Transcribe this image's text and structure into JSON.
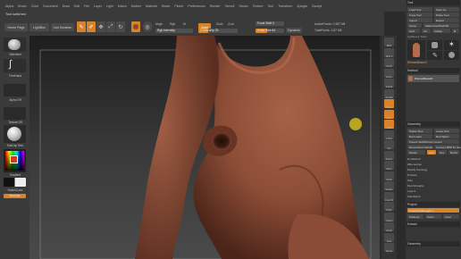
{
  "menu": [
    "Alpha",
    "Brush",
    "Color",
    "Document",
    "Draw",
    "Edit",
    "File",
    "Layer",
    "Light",
    "Macro",
    "Marker",
    "Material",
    "Movie",
    "Picker",
    "Preferences",
    "Render",
    "Stencil",
    "Stroke",
    "Texture",
    "Tool",
    "Transform",
    "Zplugin",
    "Zscript"
  ],
  "status": {
    "text": "Tool switched"
  },
  "toolbar": {
    "home_page": "Home Page",
    "lightbox": "LightBox",
    "live_boolean": "Live Boolean",
    "edit": "Edit",
    "draw": "Draw",
    "move": "Move",
    "scale": "Scale",
    "rotate": "Rotate",
    "mrgb": "Mrgb",
    "rgb": "Rgb",
    "m": "M",
    "zadd": "Zadd",
    "zsub": "Zsub",
    "zcut": "Zcut",
    "rgb_intensity": "Rgb Intensity",
    "z_intensity": "Z Intensity 25",
    "focal_shift": "Focal Shift 0",
    "draw_size": "Draw Size 64",
    "dynamic": "Dynamic",
    "active_points": "ActivePoints: 2.987 Mil",
    "total_points": "TotalPoints: 2.87 Mil",
    "z_intensity_level": 0.25,
    "rgb_intensity_level": 0.0
  },
  "left": {
    "standard": "Standard",
    "freehand": "FreeHand",
    "alpha_off": "Alpha Off",
    "texture_off": "Texture Off",
    "material": "MatCap Red",
    "gradient": "Gradient",
    "switch_color": "SwitchColor",
    "alternate": "Alternate"
  },
  "right_tools": [
    "BPR",
    "SPix 3",
    "Scroll",
    "Zoom",
    "Actual",
    "AAHalf",
    "Persp",
    "Floor",
    "Local",
    "L.Sym",
    "Xyz",
    "Frame",
    "Move",
    "Scale",
    "Rotate",
    "Line Fill",
    "PolyF",
    "Transp",
    "Ghost",
    "Solo",
    "Xpose"
  ],
  "right": {
    "title": "Tool",
    "load_tool": "Load Tool",
    "save_as": "Save As",
    "copy_tool": "Copy Tool",
    "paste_tool": "Paste Tool",
    "import": "Import",
    "export": "Export",
    "clone": "Clone",
    "make_polymesh": "Make PolyMesh3D",
    "goz": "GoZ",
    "all": "All",
    "visible": "Visible",
    "r": "R",
    "lightbox_tools": "Lightbox ▸ Tools",
    "tool_name": "WomanBase04",
    "subtool": "Subtool",
    "subtool_item": "WomanBase04",
    "geometry": "Geometry",
    "higher_res": "Higher Res",
    "lower_res": "Lower Res",
    "sdiv": "SDiv",
    "del_lower": "Del Lower",
    "del_higher": "Del Higher",
    "freeze": "Freeze SubDivision Levels",
    "reconstruct": "Reconstruct Subdiv",
    "convert_bpr": "Convert BPR To Geo",
    "divide": "Divide",
    "smt": "Smt",
    "suv": "Suv",
    "reuv": "ReUV",
    "dynamesh": "DynaMesh",
    "zremesher": "ZRemesher",
    "modify_topology": "Modify Topology",
    "position": "Position",
    "size": "Size",
    "meshintegrity": "MeshIntegrity",
    "layers": "Layers",
    "fibermesh": "FiberMesh",
    "geometry_hd": "Geometry HD",
    "preview": "Preview",
    "surface": "Surface",
    "deformation": "Deformation",
    "masking": "Masking",
    "visibility": "Visibility",
    "polygroups": "Polygroups",
    "contact": "Contact",
    "morph_target": "Morph Target",
    "polypaint": "Polypaint",
    "uv_map": "UV Map",
    "texture_map": "Texture Map",
    "displacement_map": "Displacement Map",
    "normal_map": "Normal Map",
    "vector_displacement": "Vector Displacement Map",
    "display_properties": "Display Properties",
    "unified_skin": "Unified Skin",
    "initialize": "Initialize",
    "import2": "Import",
    "export2": "Export",
    "project": "Project",
    "projection_strength": "ProjectionStrength 1",
    "farthest": "Farthest",
    "outer": "Outer",
    "inner": "Inner",
    "extract": "Extract",
    "geometry2": "Geometry"
  },
  "colors": {
    "accent": "#d8822a",
    "skin": "#9e5a40",
    "marker": "#c7b21e"
  }
}
